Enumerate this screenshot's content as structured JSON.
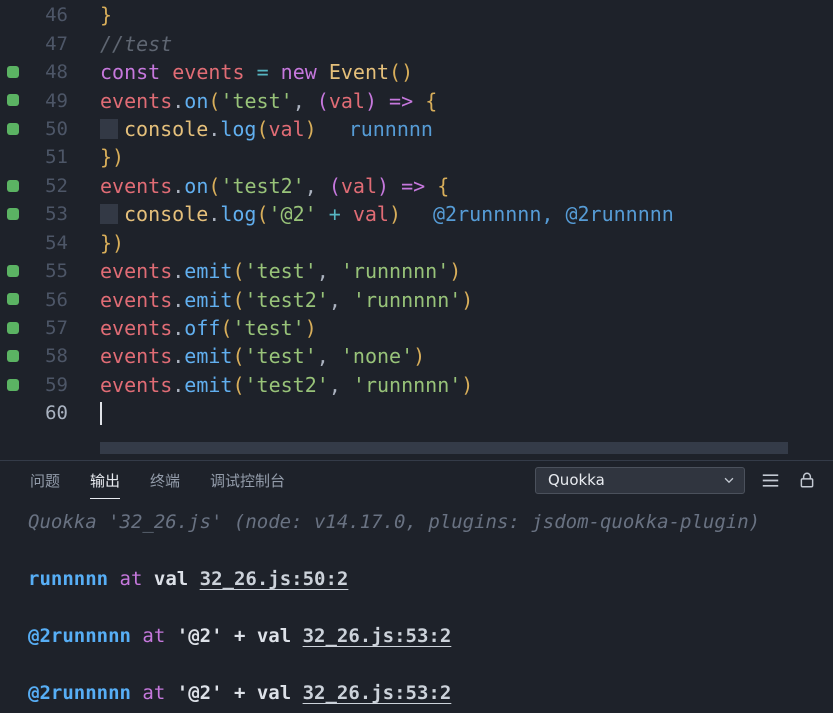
{
  "colors": {
    "bg": "#1e222a",
    "panelBorder": "#343b48",
    "marker": "#5bb363",
    "gutter": "#4d5667",
    "gutterActive": "#a9b2c0",
    "kw": "#c678dd",
    "variable": "#e06c75",
    "cls": "#e5c07b",
    "fn": "#61afef",
    "str": "#98c379",
    "op": "#56b6c2",
    "punc": "#abb2bf",
    "b1": "#d8ae5a",
    "b2": "#c678dd",
    "comment": "#5f6672",
    "inline": "#569cd6",
    "indentBox": "#333945",
    "cursor": "#e0e3e8",
    "scrollThumb": "#343b48",
    "tabInactive": "#939caa",
    "tabActive": "#e8ebf0",
    "dropdownBg": "#30353f",
    "dropdownBorder": "#4b515c",
    "iconColor": "#c3c9d2",
    "outMeta": "#697282",
    "outVal": "#57aef5",
    "outAt": "#c678dd",
    "outExpr": "#dde1e8",
    "outLink": "#ccd2da"
  },
  "editor": {
    "lines": [
      {
        "num": "46",
        "marker": false,
        "tokens": [
          [
            "b1",
            "}"
          ]
        ]
      },
      {
        "num": "47",
        "marker": false,
        "tokens": [
          [
            "comment",
            "//test"
          ]
        ]
      },
      {
        "num": "48",
        "marker": true,
        "tokens": [
          [
            "kw",
            "const"
          ],
          [
            "plain",
            " "
          ],
          [
            "var",
            "events"
          ],
          [
            "plain",
            " "
          ],
          [
            "op",
            "="
          ],
          [
            "plain",
            " "
          ],
          [
            "kw",
            "new"
          ],
          [
            "plain",
            " "
          ],
          [
            "cls",
            "Event"
          ],
          [
            "b1",
            "()"
          ]
        ]
      },
      {
        "num": "49",
        "marker": true,
        "tokens": [
          [
            "var",
            "events"
          ],
          [
            "punc",
            "."
          ],
          [
            "fn",
            "on"
          ],
          [
            "b1",
            "("
          ],
          [
            "str",
            "'test'"
          ],
          [
            "punc",
            ", "
          ],
          [
            "b2",
            "("
          ],
          [
            "var",
            "val"
          ],
          [
            "b2",
            ")"
          ],
          [
            "plain",
            " "
          ],
          [
            "kw",
            "=>"
          ],
          [
            "plain",
            " "
          ],
          [
            "b1",
            "{"
          ]
        ]
      },
      {
        "num": "50",
        "marker": true,
        "tokens": [
          [
            "indent",
            ""
          ],
          [
            "cls",
            "console"
          ],
          [
            "punc",
            "."
          ],
          [
            "fn",
            "log"
          ],
          [
            "b1",
            "("
          ],
          [
            "var",
            "val"
          ],
          [
            "b1",
            ")"
          ],
          [
            "inline",
            "runnnnn"
          ]
        ]
      },
      {
        "num": "51",
        "marker": false,
        "tokens": [
          [
            "b1",
            "})"
          ]
        ]
      },
      {
        "num": "52",
        "marker": true,
        "tokens": [
          [
            "var",
            "events"
          ],
          [
            "punc",
            "."
          ],
          [
            "fn",
            "on"
          ],
          [
            "b1",
            "("
          ],
          [
            "str",
            "'test2'"
          ],
          [
            "punc",
            ", "
          ],
          [
            "b2",
            "("
          ],
          [
            "var",
            "val"
          ],
          [
            "b2",
            ")"
          ],
          [
            "plain",
            " "
          ],
          [
            "kw",
            "=>"
          ],
          [
            "plain",
            " "
          ],
          [
            "b1",
            "{"
          ]
        ]
      },
      {
        "num": "53",
        "marker": true,
        "tokens": [
          [
            "indent",
            ""
          ],
          [
            "cls",
            "console"
          ],
          [
            "punc",
            "."
          ],
          [
            "fn",
            "log"
          ],
          [
            "b1",
            "("
          ],
          [
            "str",
            "'@2'"
          ],
          [
            "plain",
            " "
          ],
          [
            "op",
            "+"
          ],
          [
            "plain",
            " "
          ],
          [
            "var",
            "val"
          ],
          [
            "b1",
            ")"
          ],
          [
            "inline",
            "@2runnnnn, @2runnnnn"
          ]
        ]
      },
      {
        "num": "54",
        "marker": false,
        "tokens": [
          [
            "b1",
            "})"
          ]
        ]
      },
      {
        "num": "55",
        "marker": true,
        "tokens": [
          [
            "var",
            "events"
          ],
          [
            "punc",
            "."
          ],
          [
            "fn",
            "emit"
          ],
          [
            "b1",
            "("
          ],
          [
            "str",
            "'test'"
          ],
          [
            "punc",
            ", "
          ],
          [
            "str",
            "'runnnnn'"
          ],
          [
            "b1",
            ")"
          ]
        ]
      },
      {
        "num": "56",
        "marker": true,
        "tokens": [
          [
            "var",
            "events"
          ],
          [
            "punc",
            "."
          ],
          [
            "fn",
            "emit"
          ],
          [
            "b1",
            "("
          ],
          [
            "str",
            "'test2'"
          ],
          [
            "punc",
            ", "
          ],
          [
            "str",
            "'runnnnn'"
          ],
          [
            "b1",
            ")"
          ]
        ]
      },
      {
        "num": "57",
        "marker": true,
        "tokens": [
          [
            "var",
            "events"
          ],
          [
            "punc",
            "."
          ],
          [
            "fn",
            "off"
          ],
          [
            "b1",
            "("
          ],
          [
            "str",
            "'test'"
          ],
          [
            "b1",
            ")"
          ]
        ]
      },
      {
        "num": "58",
        "marker": true,
        "tokens": [
          [
            "var",
            "events"
          ],
          [
            "punc",
            "."
          ],
          [
            "fn",
            "emit"
          ],
          [
            "b1",
            "("
          ],
          [
            "str",
            "'test'"
          ],
          [
            "punc",
            ", "
          ],
          [
            "str",
            "'none'"
          ],
          [
            "b1",
            ")"
          ]
        ]
      },
      {
        "num": "59",
        "marker": true,
        "tokens": [
          [
            "var",
            "events"
          ],
          [
            "punc",
            "."
          ],
          [
            "fn",
            "emit"
          ],
          [
            "b1",
            "("
          ],
          [
            "str",
            "'test2'"
          ],
          [
            "punc",
            ", "
          ],
          [
            "str",
            "'runnnnn'"
          ],
          [
            "b1",
            ")"
          ]
        ]
      },
      {
        "num": "60",
        "marker": false,
        "active": true,
        "tokens": [
          [
            "cursor",
            ""
          ]
        ]
      }
    ]
  },
  "panel": {
    "tabs": [
      {
        "label": "问题",
        "active": false
      },
      {
        "label": "输出",
        "active": true
      },
      {
        "label": "终端",
        "active": false
      },
      {
        "label": "调试控制台",
        "active": false
      }
    ],
    "channel": "Quokka",
    "output": [
      [
        [
          "meta",
          "Quokka '32_26.js' (node: v14.17.0, plugins: jsdom-quokka-plugin)"
        ]
      ],
      [
        [
          "val",
          "runnnnn"
        ],
        [
          "plain",
          " "
        ],
        [
          "at",
          "at"
        ],
        [
          "plain",
          " "
        ],
        [
          "expr",
          "val"
        ],
        [
          "plain",
          " "
        ],
        [
          "link",
          "32_26.js:50:2"
        ]
      ],
      [
        [
          "val",
          "@2runnnnn"
        ],
        [
          "plain",
          " "
        ],
        [
          "at",
          "at"
        ],
        [
          "plain",
          " "
        ],
        [
          "expr",
          "'@2' + val"
        ],
        [
          "plain",
          " "
        ],
        [
          "link",
          "32_26.js:53:2"
        ]
      ],
      [
        [
          "val",
          "@2runnnnn"
        ],
        [
          "plain",
          " "
        ],
        [
          "at",
          "at"
        ],
        [
          "plain",
          " "
        ],
        [
          "expr",
          "'@2' + val"
        ],
        [
          "plain",
          " "
        ],
        [
          "link",
          "32_26.js:53:2"
        ]
      ]
    ]
  }
}
